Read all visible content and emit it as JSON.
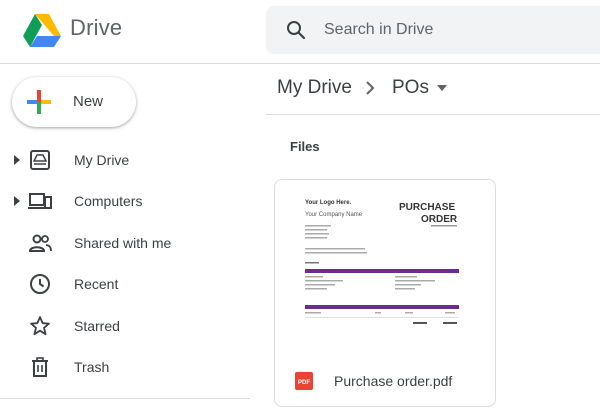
{
  "header": {
    "app_title": "Drive",
    "search_placeholder": "Search in Drive"
  },
  "sidebar": {
    "new_label": "New",
    "items": [
      {
        "label": "My Drive",
        "icon": "my-drive-icon",
        "expandable": true
      },
      {
        "label": "Computers",
        "icon": "computers-icon",
        "expandable": true
      },
      {
        "label": "Shared with me",
        "icon": "shared-with-me-icon",
        "expandable": false
      },
      {
        "label": "Recent",
        "icon": "clock-icon",
        "expandable": false
      },
      {
        "label": "Starred",
        "icon": "star-icon",
        "expandable": false
      },
      {
        "label": "Trash",
        "icon": "trash-icon",
        "expandable": false
      }
    ]
  },
  "breadcrumb": {
    "root": "My Drive",
    "current": "POs"
  },
  "main": {
    "section_heading": "Files",
    "files": [
      {
        "name": "Purchase order.pdf",
        "type_icon": "pdf-icon",
        "thumbnail": {
          "logo_text": "Your Logo Here.",
          "company_name": "Your Company Name",
          "title_line1": "PURCHASE",
          "title_line2": "ORDER",
          "vendor_header": "Vendor",
          "ship_to_header": "Ship To"
        }
      }
    ]
  },
  "colors": {
    "accent_purple": "#6a2c91",
    "pdf_red": "#ea4335",
    "search_bg": "#f1f3f4",
    "divider": "#dadce0"
  }
}
